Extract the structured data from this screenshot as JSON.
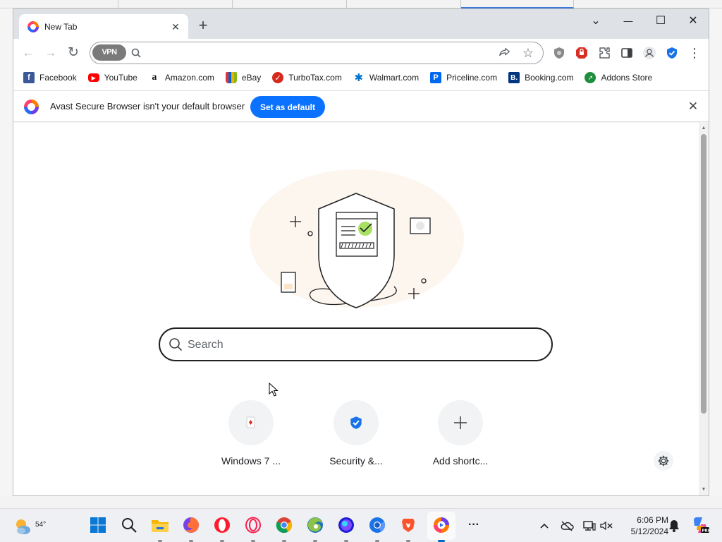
{
  "window": {
    "tab_title": "New Tab",
    "controls": {
      "dropdown": "⌄",
      "minimize": "—",
      "maximize": "☐",
      "close": "✕"
    }
  },
  "toolbar": {
    "back": "←",
    "forward": "→",
    "reload": "↻",
    "vpn_label": "VPN",
    "omnibox_value": "",
    "share": "⮫",
    "bookmark_star": "☆",
    "menu": "⋮"
  },
  "bookmarks": [
    {
      "label": "Facebook",
      "icon": "facebook-icon",
      "color": "#3b5998",
      "glyph": "f"
    },
    {
      "label": "YouTube",
      "icon": "youtube-icon",
      "color": "#ff0000",
      "glyph": "▶"
    },
    {
      "label": "Amazon.com",
      "icon": "amazon-icon",
      "color": "#ffffff",
      "glyph": "a"
    },
    {
      "label": "eBay",
      "icon": "ebay-icon",
      "color": "#e53238",
      "glyph": ""
    },
    {
      "label": "TurboTax.com",
      "icon": "turbotax-icon",
      "color": "#d52b1e",
      "glyph": "✓"
    },
    {
      "label": "Walmart.com",
      "icon": "walmart-icon",
      "color": "#0071ce",
      "glyph": "✱"
    },
    {
      "label": "Priceline.com",
      "icon": "priceline-icon",
      "color": "#0068ef",
      "glyph": "P"
    },
    {
      "label": "Booking.com",
      "icon": "booking-icon",
      "color": "#003580",
      "glyph": "B."
    },
    {
      "label": "Addons Store",
      "icon": "addons-store-icon",
      "color": "#1e8e3e",
      "glyph": "➚"
    }
  ],
  "infobar": {
    "message": "Avast Secure Browser isn't your default browser",
    "button_label": "Set as default",
    "close": "✕"
  },
  "ntp": {
    "search_placeholder": "Search",
    "shortcuts": [
      {
        "label": "Windows 7 ...",
        "icon": "windows7-games-icon"
      },
      {
        "label": "Security &...",
        "icon": "security-shield-icon"
      },
      {
        "label": "Add shortc...",
        "icon": "plus-icon"
      }
    ]
  },
  "taskbar": {
    "weather_temp": "54°",
    "time": "6:06 PM",
    "date": "5/12/2024",
    "apps": [
      "start",
      "search",
      "file-explorer",
      "firefox",
      "opera",
      "opera-gx",
      "chrome",
      "edge-dev",
      "firefox-nightly",
      "chromium",
      "brave",
      "avast-secure-browser",
      "more"
    ]
  },
  "colors": {
    "accent": "#0b72ff",
    "tabstrip": "#dee1e6",
    "vpn_pill": "#7a7a7a",
    "avast_shield": "#1a73e8"
  }
}
